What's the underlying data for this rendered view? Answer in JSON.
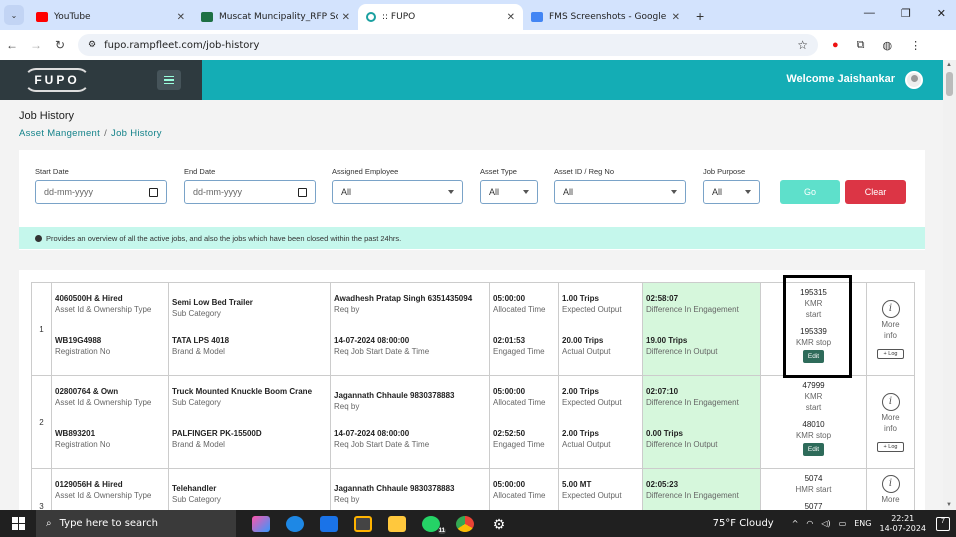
{
  "browser": {
    "tabs": [
      {
        "title": "YouTube",
        "color": "#ff0000"
      },
      {
        "title": "Muscat Muncipality_RFP Scope",
        "color": "#1d7044"
      },
      {
        "title": ":: FUPO",
        "color": "#1aa0a0"
      },
      {
        "title": "FMS Screenshots - Google Drive",
        "color": "#4285f4"
      }
    ],
    "url": "fupo.rampfleet.com/job-history"
  },
  "header": {
    "logo": "FUPO",
    "welcome": "Welcome Jaishankar"
  },
  "page": {
    "title": "Job History",
    "breadcrumb": [
      "Asset Mangement",
      "Job History"
    ],
    "breadcrumb_sep": "/"
  },
  "filters": {
    "start_date": {
      "label": "Start Date",
      "placeholder": "dd-mm-yyyy"
    },
    "end_date": {
      "label": "End Date",
      "placeholder": "dd-mm-yyyy"
    },
    "assigned_employee": {
      "label": "Assigned Employee",
      "value": "All"
    },
    "asset_type": {
      "label": "Asset Type",
      "value": "All"
    },
    "asset_id": {
      "label": "Asset ID / Reg No",
      "value": "All"
    },
    "job_purpose": {
      "label": "Job Purpose",
      "value": "All"
    },
    "go": "Go",
    "clear": "Clear",
    "info": "Provides an overview of all the active jobs, and also the jobs which have been closed within the past 24hrs."
  },
  "rows": [
    {
      "num": "1",
      "asset": "4060500H & Hired",
      "asset_l": "Asset Id & Ownership Type",
      "reg": "WB19G4988",
      "reg_l": "Registration No",
      "cat": "Semi Low Bed Trailer",
      "cat_l": "Sub Category",
      "brand": "TATA LPS 4018",
      "brand_l": "Brand & Model",
      "req": "Awadhesh Pratap Singh 6351435094",
      "req_l": "Req by",
      "start": "14-07-2024 08:00:00",
      "start_l": "Req Job Start Date & Time",
      "alloc": "05:00:00",
      "alloc_l": "Allocated Time",
      "eng": "02:01:53",
      "eng_l": "Engaged Time",
      "exp": "1.00 Trips",
      "exp_l": "Expected Output",
      "act": "20.00 Trips",
      "act_l": "Actual Output",
      "deng": "02:58:07",
      "deng_l": "Difference In Engagement",
      "dout": "19.00 Trips",
      "dout_l": "Difference In Output",
      "m1": "195315",
      "m1_l": "KMR start",
      "m2": "195339",
      "m2_l": "KMR stop",
      "edit": "Edit",
      "more": "More info",
      "log": "+ Log"
    },
    {
      "num": "2",
      "asset": "02800764 & Own",
      "asset_l": "Asset Id & Ownership Type",
      "reg": "WB893201",
      "reg_l": "Registration No",
      "cat": "Truck Mounted Knuckle Boom Crane",
      "cat_l": "Sub Category",
      "brand": "PALFINGER PK-15500D",
      "brand_l": "Brand & Model",
      "req": "Jagannath Chhaule 9830378883",
      "req_l": "Req by",
      "start": "14-07-2024 08:00:00",
      "start_l": "Req Job Start Date & Time",
      "alloc": "05:00:00",
      "alloc_l": "Allocated Time",
      "eng": "02:52:50",
      "eng_l": "Engaged Time",
      "exp": "2.00 Trips",
      "exp_l": "Expected Output",
      "act": "2.00 Trips",
      "act_l": "Actual Output",
      "deng": "02:07:10",
      "deng_l": "Difference In Engagement",
      "dout": "0.00 Trips",
      "dout_l": "Difference In Output",
      "m1": "47999",
      "m1_l": "KMR start",
      "m2": "48010",
      "m2_l": "KMR stop",
      "edit": "Edit",
      "more": "More info",
      "log": "+ Log"
    },
    {
      "num": "3",
      "asset": "0129056H & Hired",
      "asset_l": "Asset Id & Ownership Type",
      "cat": "Telehandler",
      "cat_l": "Sub Category",
      "req": "Jagannath Chhaule 9830378883",
      "req_l": "Req by",
      "alloc": "05:00:00",
      "alloc_l": "Allocated Time",
      "exp": "5.00 MT",
      "exp_l": "Expected Output",
      "deng": "02:05:23",
      "deng_l": "Difference In Engagement",
      "m1": "5074",
      "m1_l": "HMR start",
      "m2": "5077",
      "more": "More"
    }
  ],
  "taskbar": {
    "search": "Type here to search",
    "weather": "75°F  Cloudy",
    "lang": "ENG",
    "time": "22:21",
    "date": "14-07-2024",
    "badge": "11",
    "notif": "7"
  }
}
